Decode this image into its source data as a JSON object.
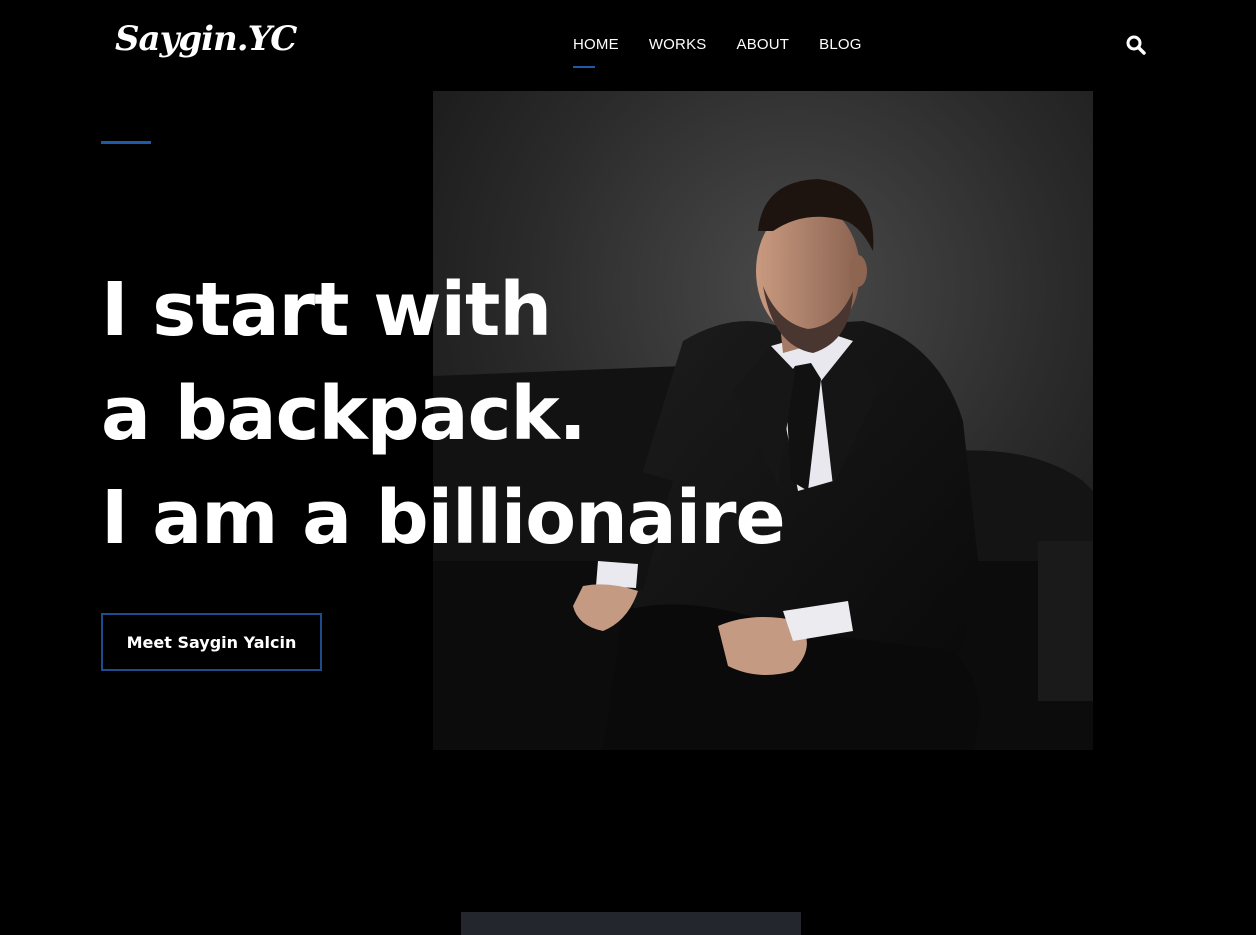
{
  "header": {
    "logo": "Saygin.YC",
    "nav": [
      {
        "label": "HOME",
        "active": true
      },
      {
        "label": "WORKS",
        "active": false
      },
      {
        "label": "ABOUT",
        "active": false
      },
      {
        "label": "BLOG",
        "active": false
      }
    ],
    "search_icon": "search-icon"
  },
  "hero": {
    "headline_lines": [
      "I start with",
      "a backpack.",
      "I am a billionaire"
    ],
    "cta_label": "Meet Saygin Yalcin",
    "photo_subject": "portrait-photo"
  },
  "colors": {
    "background": "#000000",
    "accent": "#1e5aa8",
    "text": "#ffffff",
    "bottom_bar": "#23272d"
  }
}
